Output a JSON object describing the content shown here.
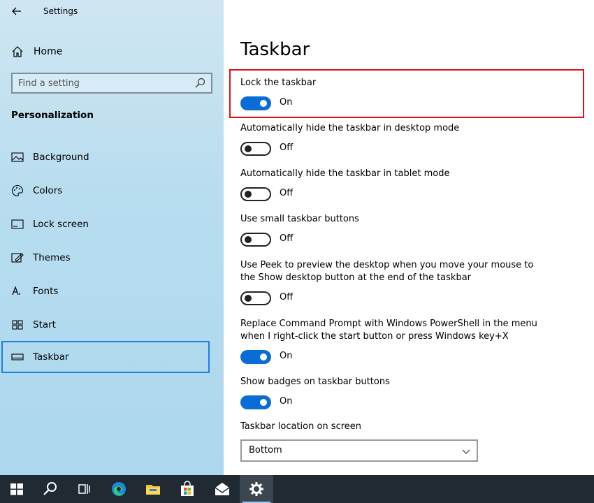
{
  "window": {
    "title": "Settings"
  },
  "sidebar": {
    "home_label": "Home",
    "search_placeholder": "Find a setting",
    "section_title": "Personalization",
    "items": [
      {
        "label": "Background",
        "icon": "picture-icon"
      },
      {
        "label": "Colors",
        "icon": "palette-icon"
      },
      {
        "label": "Lock screen",
        "icon": "lock-screen-icon"
      },
      {
        "label": "Themes",
        "icon": "brush-icon"
      },
      {
        "label": "Fonts",
        "icon": "font-icon"
      },
      {
        "label": "Start",
        "icon": "start-grid-icon"
      },
      {
        "label": "Taskbar",
        "icon": "taskbar-icon",
        "active": true
      }
    ]
  },
  "main": {
    "page_title": "Taskbar",
    "settings": [
      {
        "title": "Lock the taskbar",
        "state": "On"
      },
      {
        "title": "Automatically hide the taskbar in desktop mode",
        "state": "Off"
      },
      {
        "title": "Automatically hide the taskbar in tablet mode",
        "state": "Off"
      },
      {
        "title": "Use small taskbar buttons",
        "state": "Off"
      },
      {
        "title": "Use Peek to preview the desktop when you move your mouse to the Show desktop button at the end of the taskbar",
        "state": "Off"
      },
      {
        "title": "Replace Command Prompt with Windows PowerShell in the menu when I right-click the start button or press Windows key+X",
        "state": "On"
      },
      {
        "title": "Show badges on taskbar buttons",
        "state": "On"
      }
    ],
    "location_label": "Taskbar location on screen",
    "location_value": "Bottom"
  },
  "taskbar": {
    "buttons": [
      "windows-start-icon",
      "search-icon",
      "task-view-icon",
      "edge-icon",
      "file-explorer-icon",
      "store-icon",
      "mail-icon",
      "settings-gear-icon"
    ]
  },
  "colors": {
    "accent": "#0a6cd6",
    "highlight_box": "#e0101b",
    "active_nav_border": "#1a7fe0",
    "taskbar_bg": "#1f2a33"
  }
}
